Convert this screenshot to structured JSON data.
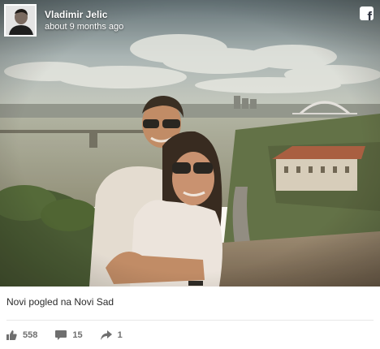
{
  "post": {
    "author": "Vladimir Jelic",
    "timestamp": "about 9 months ago",
    "caption": "Novi pogled na Novi Sad",
    "platform_icon": "facebook-icon"
  },
  "stats": {
    "likes": "558",
    "comments": "15",
    "shares": "1",
    "icons": [
      "thumbs-up-icon",
      "comment-icon",
      "share-icon"
    ]
  },
  "colors": {
    "text": "#2b2b2b",
    "stat_text": "#6f6f6f",
    "divider": "#e8e8e8"
  }
}
